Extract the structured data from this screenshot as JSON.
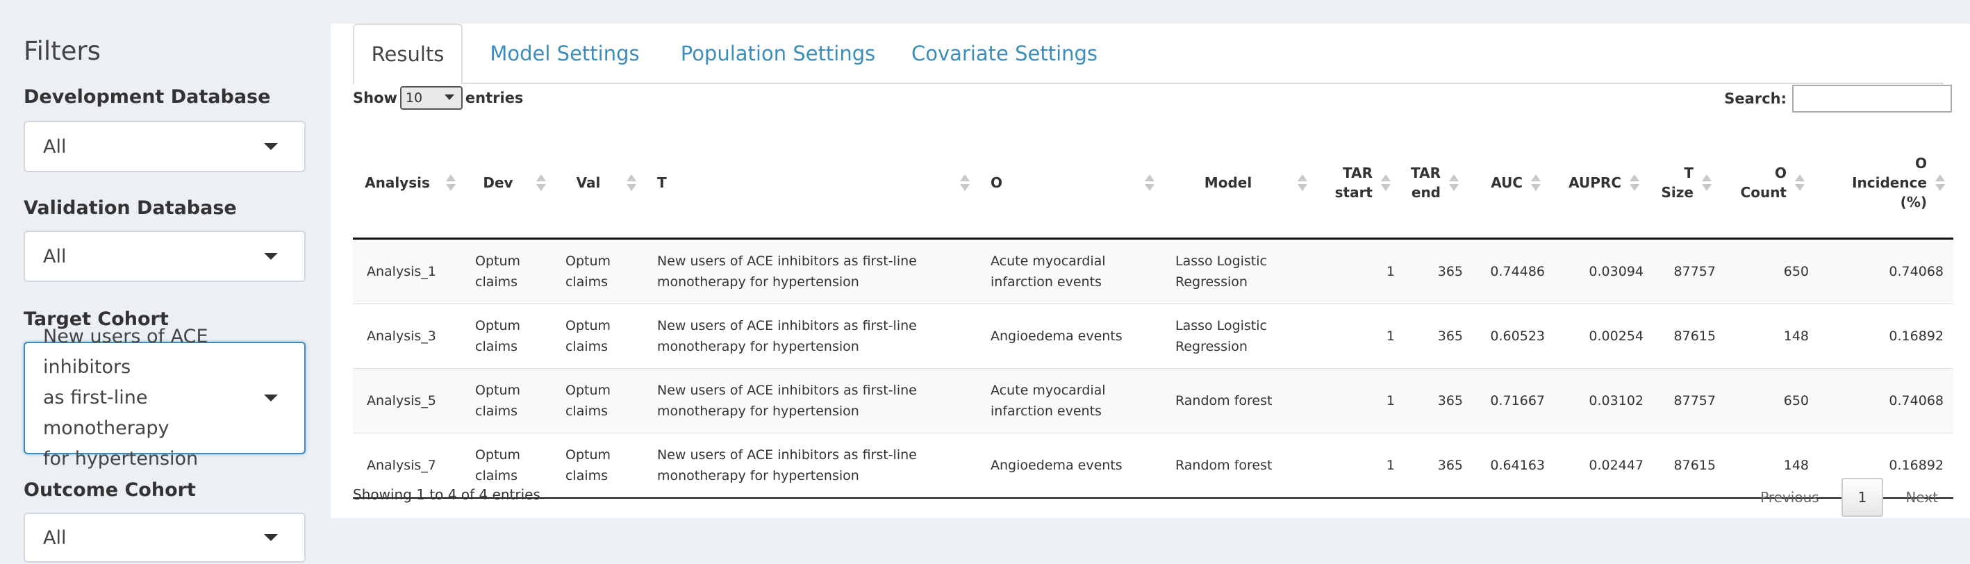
{
  "sidebar": {
    "title": "Filters",
    "filters": [
      {
        "label": "Development Database",
        "value": "All"
      },
      {
        "label": "Validation Database",
        "value": "All"
      },
      {
        "label": "Target Cohort",
        "value_lines": [
          "New users of ACE inhibitors",
          "as first-line monotherapy",
          "for hypertension"
        ]
      },
      {
        "label": "Outcome Cohort",
        "value": "All"
      }
    ]
  },
  "tabs": [
    "Results",
    "Model Settings",
    "Population Settings",
    "Covariate Settings"
  ],
  "table_controls": {
    "show_label": "Show",
    "page_length": "10",
    "entries_label": "entries",
    "search_label": "Search:",
    "search_value": ""
  },
  "table": {
    "headers": [
      [
        "Analysis"
      ],
      [
        "Dev"
      ],
      [
        "Val"
      ],
      [
        "T"
      ],
      [
        "O"
      ],
      [
        "Model"
      ],
      [
        "TAR",
        "start"
      ],
      [
        "TAR",
        "end"
      ],
      [
        "AUC"
      ],
      [
        "AUPRC"
      ],
      [
        "T",
        "Size"
      ],
      [
        "O",
        "Count"
      ],
      [
        "O",
        "Incidence",
        "(%)"
      ]
    ],
    "rows": [
      {
        "analysis": "Analysis_1",
        "dev": [
          "Optum",
          "claims"
        ],
        "val": [
          "Optum",
          "claims"
        ],
        "t": [
          "New users of ACE inhibitors as first-line",
          "monotherapy for hypertension"
        ],
        "o": [
          "Acute myocardial",
          "infarction events"
        ],
        "model": [
          "Lasso Logistic",
          "Regression"
        ],
        "tar_start": "1",
        "tar_end": "365",
        "auc": "0.74486",
        "auprc": "0.03094",
        "t_size": "87757",
        "o_count": "650",
        "o_incidence": "0.74068"
      },
      {
        "analysis": "Analysis_3",
        "dev": [
          "Optum",
          "claims"
        ],
        "val": [
          "Optum",
          "claims"
        ],
        "t": [
          "New users of ACE inhibitors as first-line",
          "monotherapy for hypertension"
        ],
        "o": [
          "Angioedema events"
        ],
        "model": [
          "Lasso Logistic",
          "Regression"
        ],
        "tar_start": "1",
        "tar_end": "365",
        "auc": "0.60523",
        "auprc": "0.00254",
        "t_size": "87615",
        "o_count": "148",
        "o_incidence": "0.16892"
      },
      {
        "analysis": "Analysis_5",
        "dev": [
          "Optum",
          "claims"
        ],
        "val": [
          "Optum",
          "claims"
        ],
        "t": [
          "New users of ACE inhibitors as first-line",
          "monotherapy for hypertension"
        ],
        "o": [
          "Acute myocardial",
          "infarction events"
        ],
        "model": [
          "Random forest"
        ],
        "tar_start": "1",
        "tar_end": "365",
        "auc": "0.71667",
        "auprc": "0.03102",
        "t_size": "87757",
        "o_count": "650",
        "o_incidence": "0.74068"
      },
      {
        "analysis": "Analysis_7",
        "dev": [
          "Optum",
          "claims"
        ],
        "val": [
          "Optum",
          "claims"
        ],
        "t": [
          "New users of ACE inhibitors as first-line",
          "monotherapy for hypertension"
        ],
        "o": [
          "Angioedema events"
        ],
        "model": [
          "Random forest"
        ],
        "tar_start": "1",
        "tar_end": "365",
        "auc": "0.64163",
        "auprc": "0.02447",
        "t_size": "87615",
        "o_count": "148",
        "o_incidence": "0.16892"
      }
    ]
  },
  "footer": {
    "info": "Showing 1 to 4 of 4 entries",
    "previous": "Previous",
    "current_page": "1",
    "next": "Next"
  },
  "icons": {
    "dropdown": "caret-down-icon",
    "sort": "sort-both-icon"
  }
}
